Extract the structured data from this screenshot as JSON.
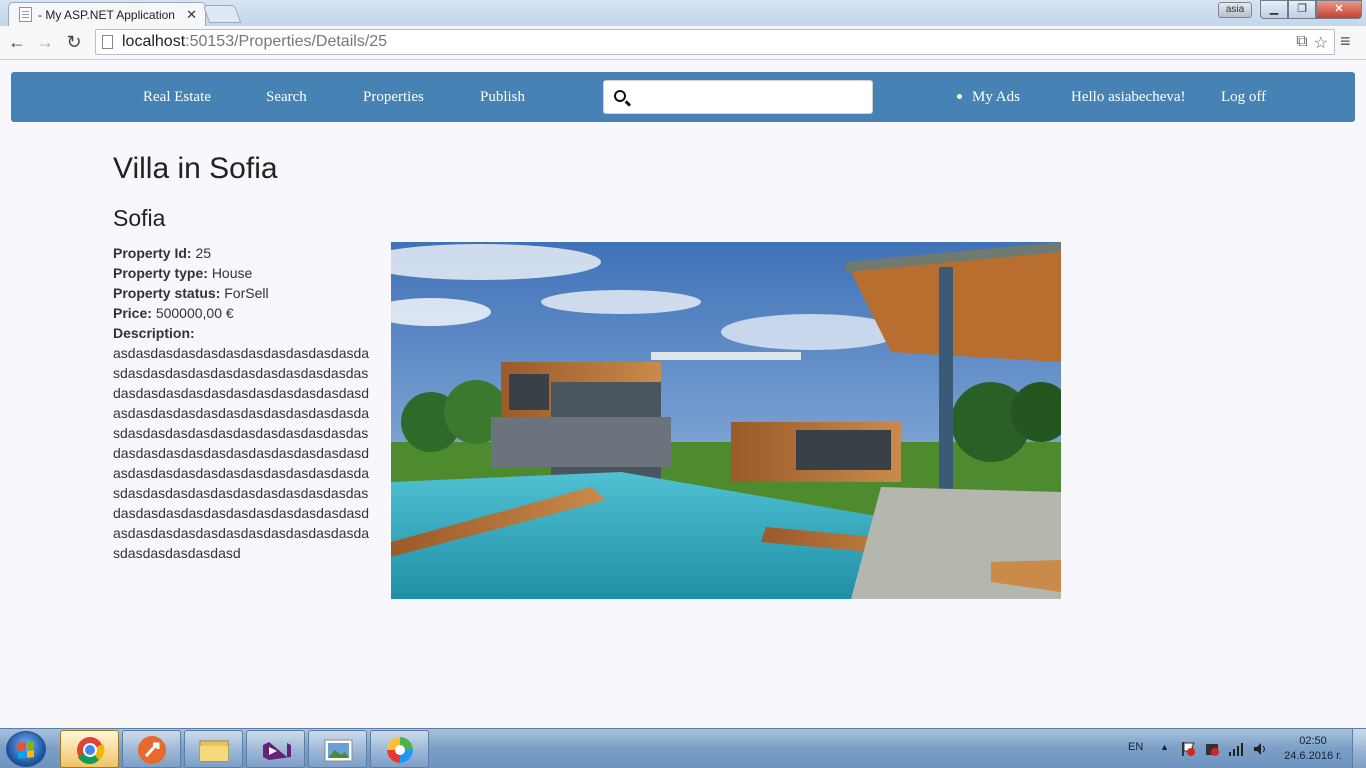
{
  "browser": {
    "tab_title": "- My ASP.NET Application",
    "tab_close": "✕",
    "user_badge": "asia",
    "window_min": "▁",
    "window_max": "❐",
    "window_close": "✕",
    "back_icon": "←",
    "forward_icon": "→",
    "reload_icon": "↻",
    "url_host": "localhost",
    "url_path": ":50153/Properties/Details/25",
    "translate_icon": "⧉",
    "star_icon": "☆",
    "menu_icon": "≡"
  },
  "navbar": {
    "brand": "Real Estate",
    "links": [
      "Search",
      "Properties",
      "Publish"
    ],
    "search_placeholder": "",
    "my_ads": "My Ads",
    "greeting": "Hello asiabecheva!",
    "logoff": "Log off"
  },
  "property": {
    "title": "Villa in Sofia",
    "city": "Sofia",
    "id_label": "Property Id:",
    "id_value": "25",
    "type_label": "Property type:",
    "type_value": "House",
    "status_label": "Property status:",
    "status_value": "ForSell",
    "price_label": "Price:",
    "price_value": "500000,00 €",
    "description_label": "Description:",
    "description_text": "asdasdasdasdasdasdasdasdasdasdasdasdasdasdasdasdasdasdasdasdasdasdasdasdasdasdasdasdasdasdasdasdasdasdasdasdasdasdasdasdasdasdasdasdasdasdasdasdasdasdasdasdasdasdasdasdasdasdasdasdasdasdasdasdasdasdasdasdasdasdasdasdasdasdasdasdasdasdasdasdasdasdasdasdasdasdasdasdasdasdasdasdasdasdasdasdasdasdasdasdasdasdasdasdasdasdasdasdasdasdasdasdasdasdasdasdasdasdasd"
  },
  "taskbar": {
    "lang": "EN",
    "tray_up": "▲",
    "time": "02:50",
    "date": "24.6.2016 г."
  }
}
